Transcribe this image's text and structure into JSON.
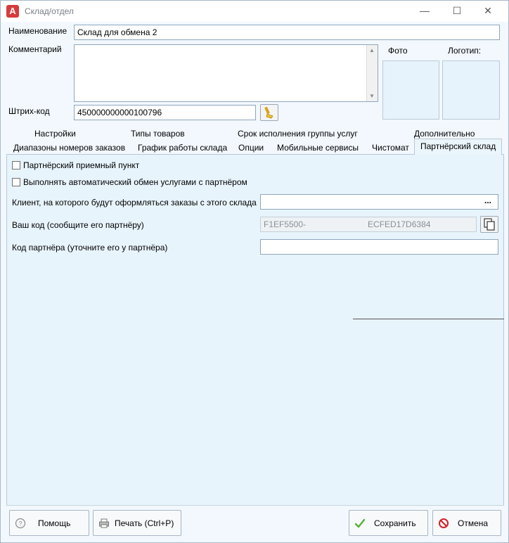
{
  "window": {
    "title": "Склад/отдел",
    "app_icon_letter": "A",
    "controls": {
      "minimize": "—",
      "maximize": "☐",
      "close": "✕"
    }
  },
  "form": {
    "name_label": "Наименование",
    "name_value": "Склад для обмена 2",
    "comment_label": "Комментарий",
    "comment_value": "",
    "barcode_label": "Штрих-код",
    "barcode_value": "450000000000100796",
    "photo_label": "Фото",
    "logo_label": "Логотип:"
  },
  "tabs": {
    "row1": [
      "Настройки",
      "Типы товаров",
      "Срок исполнения группы услуг",
      "Дополнительно"
    ],
    "row2": [
      "Диапазоны номеров заказов",
      "График работы склада",
      "Опции",
      "Мобильные сервисы",
      "Чистомат",
      "Партнёрский склад"
    ],
    "active": "Партнёрский склад"
  },
  "partner": {
    "checkbox_receiving_point": "Партнёрский приемный пункт",
    "checkbox_auto_exchange": "Выполнять автоматический обмен услугами с партнёром",
    "client_label": "Клиент, на которого будут оформляться заказы с этого склада",
    "client_value": "",
    "client_button": "...",
    "your_code_label": "Ваш код (сообщите его партнёру)",
    "your_code_prefix": "F1EF5500-",
    "your_code_suffix": "ECFED17D6384",
    "partner_code_label": "Код партнёра (уточните его у партнёра)",
    "partner_code_value": ""
  },
  "footer": {
    "help": "Помощь",
    "print": "Печать (Ctrl+P)",
    "save": "Сохранить",
    "cancel": "Отмена"
  },
  "colors": {
    "background": "#eaf3fb",
    "app_icon": "#d83b3b",
    "save_check": "#57b035",
    "cancel_icon": "#d0222a"
  }
}
